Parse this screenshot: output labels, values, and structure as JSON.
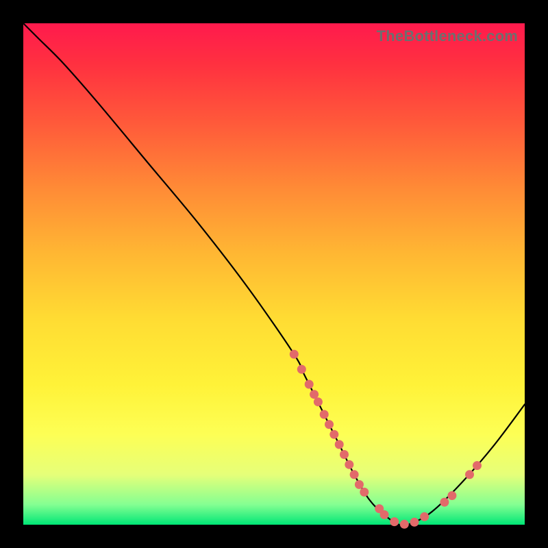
{
  "watermark": "TheBottleneck.com",
  "colors": {
    "gradient_top": "#ff1a4d",
    "gradient_bottom": "#00e676",
    "curve": "#000000",
    "point_fill": "#e26a6a",
    "frame_border": "#000000"
  },
  "chart_data": {
    "type": "line",
    "title": "",
    "xlabel": "",
    "ylabel": "",
    "xlim": [
      0,
      100
    ],
    "ylim": [
      0,
      100
    ],
    "x": [
      0,
      3,
      8,
      15,
      25,
      35,
      45,
      54,
      56,
      58,
      60,
      63,
      66,
      69,
      72,
      75,
      78,
      82,
      88,
      94,
      100
    ],
    "y": [
      100,
      97,
      92,
      84,
      72,
      60,
      47,
      34,
      30,
      26,
      22,
      16,
      10,
      5,
      2,
      0,
      0.5,
      3,
      9,
      16,
      24
    ],
    "series": [
      {
        "name": "curve",
        "x": [
          0,
          3,
          8,
          15,
          25,
          35,
          45,
          54,
          56,
          58,
          60,
          63,
          66,
          69,
          72,
          75,
          78,
          82,
          88,
          94,
          100
        ],
        "y": [
          100,
          97,
          92,
          84,
          72,
          60,
          47,
          34,
          30,
          26,
          22,
          16,
          10,
          5,
          2,
          0,
          0.5,
          3,
          9,
          16,
          24
        ]
      }
    ],
    "markers": {
      "x": [
        54,
        55.5,
        57,
        58,
        58.8,
        60,
        61,
        62,
        63,
        64,
        65,
        66,
        67,
        68,
        71,
        72,
        74,
        76,
        78,
        80,
        84,
        85.5,
        89,
        90.5
      ],
      "y": [
        34,
        31,
        28,
        26,
        24.5,
        22,
        20,
        18,
        16,
        14,
        12,
        10,
        8,
        6.5,
        3.2,
        2,
        0.6,
        0.1,
        0.5,
        1.6,
        4.5,
        5.8,
        10,
        11.8
      ]
    }
  }
}
